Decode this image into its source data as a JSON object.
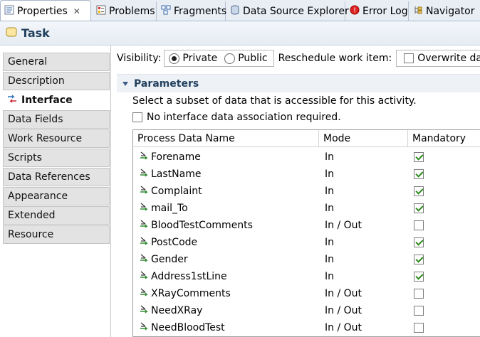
{
  "tabs": [
    {
      "label": "Properties",
      "icon": "properties-icon",
      "active": true,
      "closable": true
    },
    {
      "label": "Problems",
      "icon": "problems-icon"
    },
    {
      "label": "Fragments",
      "icon": "fragments-icon"
    },
    {
      "label": "Data Source Explorer",
      "icon": "data-source-explorer-icon"
    },
    {
      "label": "Error Log",
      "icon": "error-log-icon"
    },
    {
      "label": "Navigator",
      "icon": "navigator-icon"
    }
  ],
  "header": {
    "title": "Task",
    "icon": "task-icon"
  },
  "sidebar": {
    "items": [
      {
        "label": "General"
      },
      {
        "label": "Description"
      },
      {
        "label": "Interface",
        "active": true,
        "icon": "interface-icon"
      },
      {
        "label": "Data Fields"
      },
      {
        "label": "Work Resource"
      },
      {
        "label": "Scripts"
      },
      {
        "label": "Data References"
      },
      {
        "label": "Appearance"
      },
      {
        "label": "Extended"
      },
      {
        "label": "Resource"
      }
    ]
  },
  "visibility": {
    "label": "Visibility:",
    "options": [
      {
        "label": "Private",
        "selected": true
      },
      {
        "label": "Public",
        "selected": false
      }
    ]
  },
  "reschedule": {
    "label": "Reschedule work item:",
    "checkbox_label": "Overwrite data a",
    "checked": false
  },
  "parameters": {
    "section_title": "Parameters",
    "description": "Select a subset of data that is accessible for this activity.",
    "no_association_label": "No interface data association required.",
    "no_association_checked": false,
    "columns": [
      "Process Data Name",
      "Mode",
      "Mandatory"
    ],
    "rows": [
      {
        "name": "Forename",
        "mode": "In",
        "mandatory": true
      },
      {
        "name": "LastName",
        "mode": "In",
        "mandatory": true
      },
      {
        "name": "Complaint",
        "mode": "In",
        "mandatory": true
      },
      {
        "name": "mail_To",
        "mode": "In",
        "mandatory": true
      },
      {
        "name": "BloodTestComments",
        "mode": "In / Out",
        "mandatory": false
      },
      {
        "name": "PostCode",
        "mode": "In",
        "mandatory": true
      },
      {
        "name": "Gender",
        "mode": "In",
        "mandatory": true
      },
      {
        "name": "Address1stLine",
        "mode": "In",
        "mandatory": true
      },
      {
        "name": "XRayComments",
        "mode": "In / Out",
        "mandatory": false
      },
      {
        "name": "NeedXRay",
        "mode": "In / Out",
        "mandatory": false
      },
      {
        "name": "NeedBloodTest",
        "mode": "In / Out",
        "mandatory": false
      }
    ]
  },
  "colors": {
    "accent": "#22415e",
    "check": "#2d8a1e"
  }
}
